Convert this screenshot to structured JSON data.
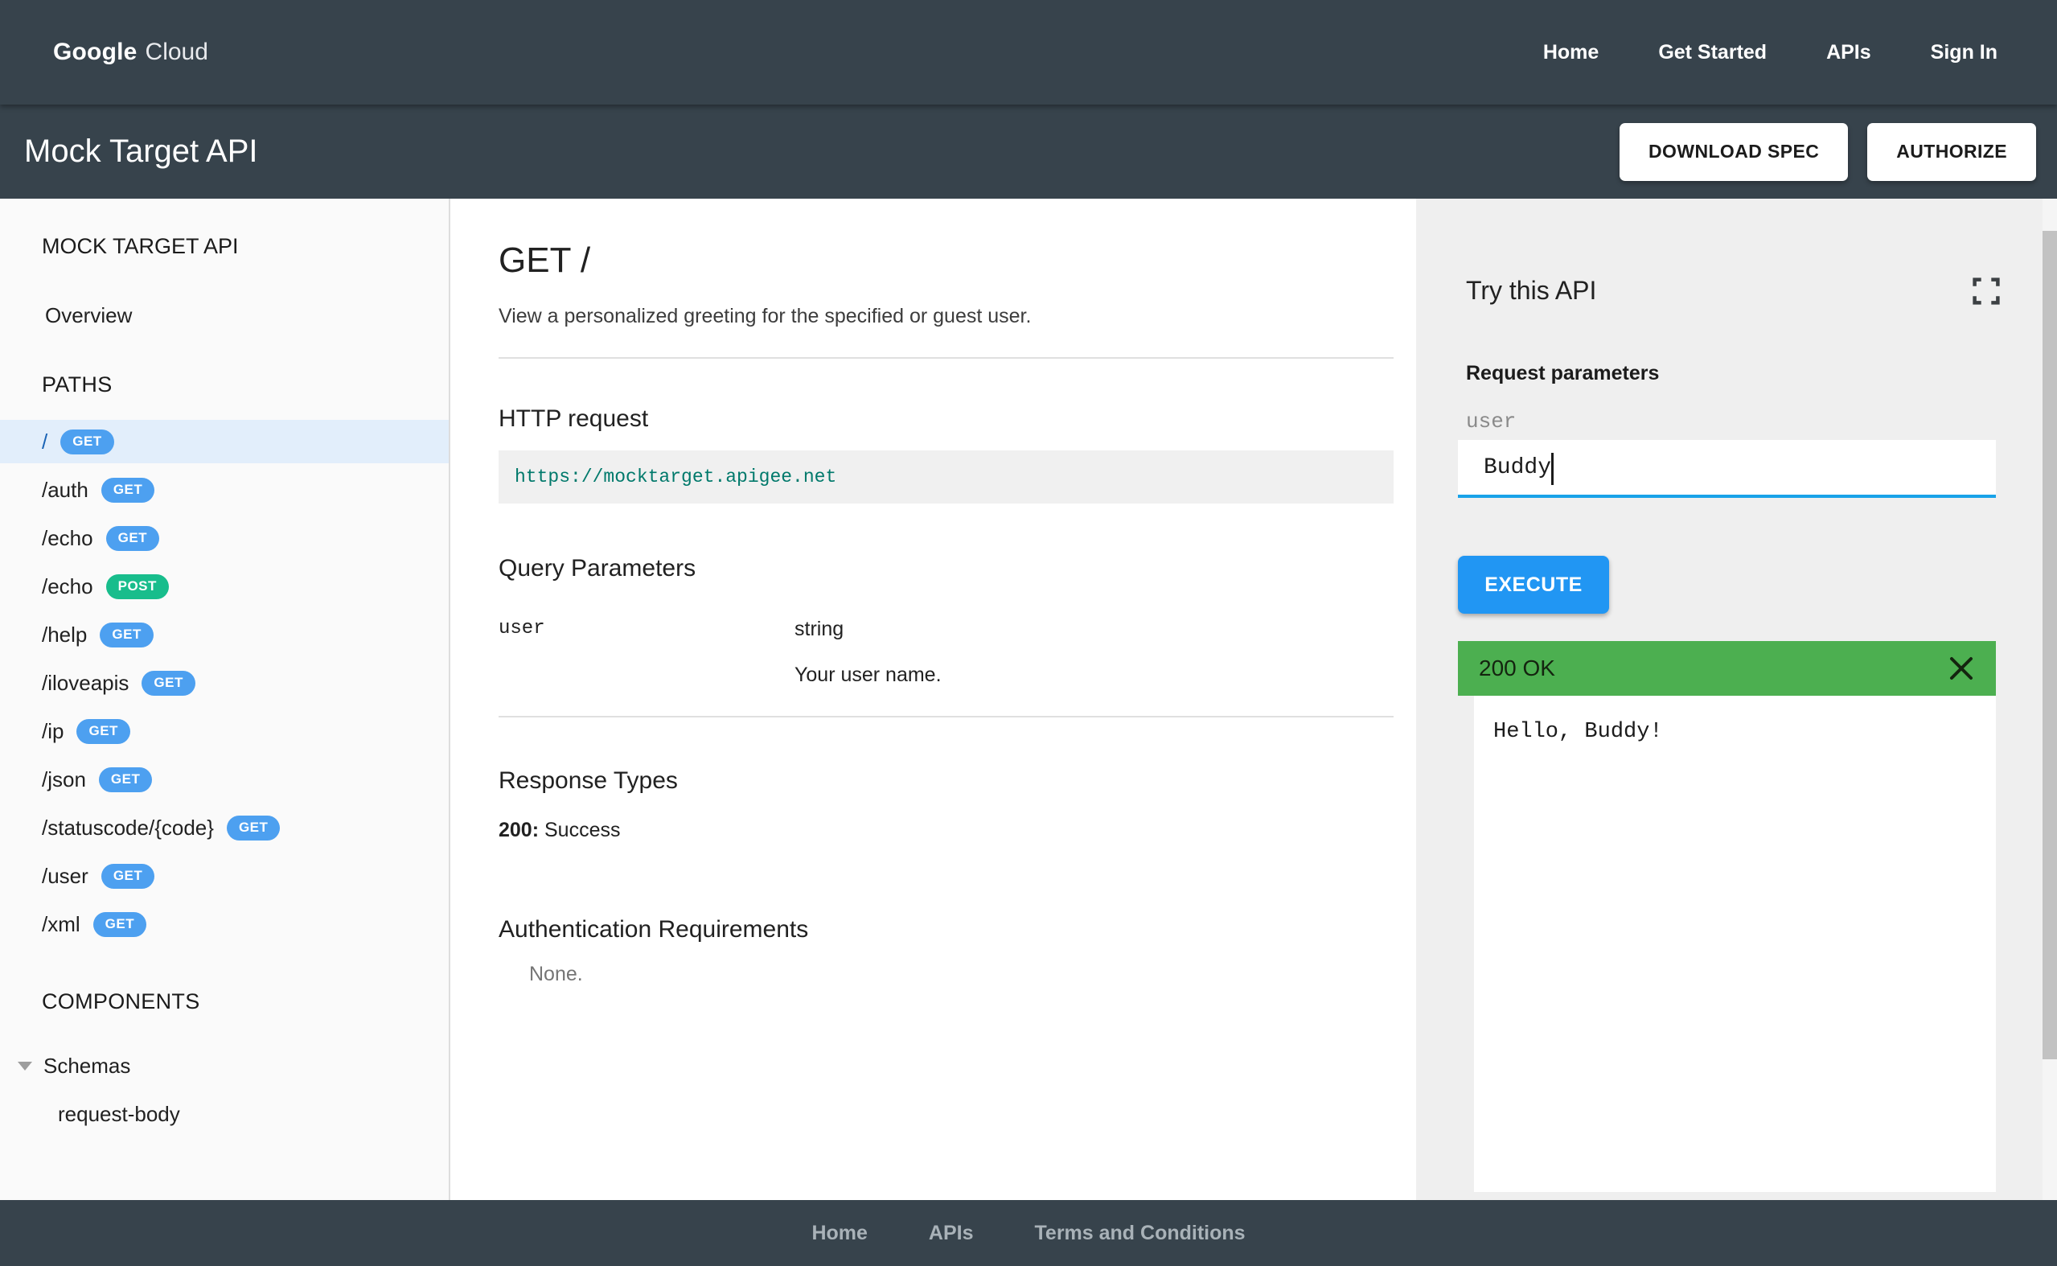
{
  "colors": {
    "bar_background": "#37434C",
    "get_badge": "#4DA0F0",
    "post_badge": "#18BD8C",
    "execute_button": "#2196F3",
    "input_underline": "#18A2E8",
    "success_green": "#4CAF50",
    "url_teal": "#00796B",
    "selected_row": "#E2EEFB"
  },
  "icons": {
    "fullscreen": "fullscreen-expand-corners",
    "close": "✕",
    "schemas_toggle": "▾"
  },
  "topnav": {
    "logo_google": "Google",
    "logo_cloud": "Cloud",
    "items": [
      {
        "label": "Home"
      },
      {
        "label": "Get Started"
      },
      {
        "label": "APIs"
      },
      {
        "label": "Sign In"
      }
    ]
  },
  "header": {
    "title": "Mock Target API",
    "download_label": "DOWNLOAD SPEC",
    "authorize_label": "AUTHORIZE"
  },
  "sidebar": {
    "api_title": "MOCK TARGET API",
    "overview_label": "Overview",
    "paths_heading": "PATHS",
    "paths": [
      {
        "path": "/",
        "method": "GET",
        "selected": true
      },
      {
        "path": "/auth",
        "method": "GET"
      },
      {
        "path": "/echo",
        "method": "GET"
      },
      {
        "path": "/echo",
        "method": "POST"
      },
      {
        "path": "/help",
        "method": "GET"
      },
      {
        "path": "/iloveapis",
        "method": "GET"
      },
      {
        "path": "/ip",
        "method": "GET"
      },
      {
        "path": "/json",
        "method": "GET"
      },
      {
        "path": "/statuscode/{code}",
        "method": "GET"
      },
      {
        "path": "/user",
        "method": "GET"
      },
      {
        "path": "/xml",
        "method": "GET"
      }
    ],
    "components_heading": "COMPONENTS",
    "schemas_label": "Schemas",
    "schema_items": [
      {
        "label": "request-body"
      }
    ]
  },
  "main": {
    "title": "GET /",
    "description": "View a personalized greeting for the specified or guest user.",
    "http_request_heading": "HTTP request",
    "http_request_url": "https://mocktarget.apigee.net",
    "query_params_heading": "Query Parameters",
    "query_params": [
      {
        "name": "user",
        "type": "string",
        "description": "Your user name."
      }
    ],
    "response_types_heading": "Response Types",
    "response_code": "200:",
    "response_description": "Success",
    "auth_heading": "Authentication Requirements",
    "auth_value": "None."
  },
  "try_panel": {
    "title": "Try this API",
    "request_params_heading": "Request parameters",
    "param_label": "user",
    "param_value": "Buddy",
    "execute_label": "EXECUTE",
    "response_status": "200 OK",
    "response_body": "Hello, Buddy!"
  },
  "footer": {
    "items": [
      {
        "label": "Home"
      },
      {
        "label": "APIs"
      },
      {
        "label": "Terms and Conditions"
      }
    ]
  }
}
